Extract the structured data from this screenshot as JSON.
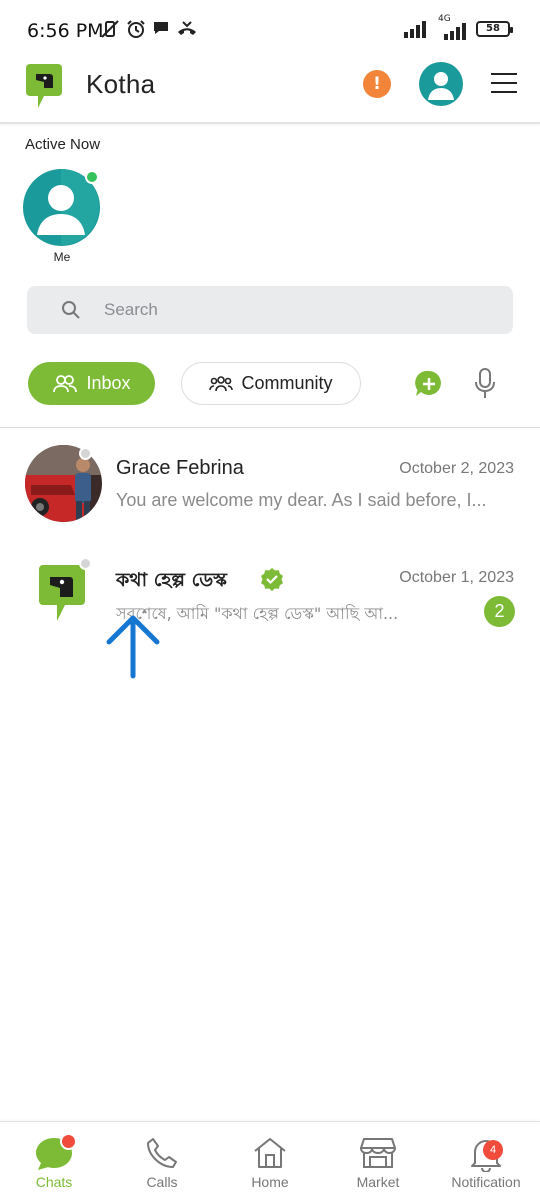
{
  "status_bar": {
    "time": "6:56 PM",
    "network": "4G",
    "battery": "58"
  },
  "header": {
    "title": "Kotha",
    "alert_symbol": "!"
  },
  "active_now": {
    "label": "Active Now",
    "users": [
      {
        "name": "Me",
        "online": true
      }
    ]
  },
  "search": {
    "placeholder": "Search"
  },
  "tabs": {
    "inbox": "Inbox",
    "community": "Community"
  },
  "chats": [
    {
      "name": "Grace Febrina",
      "date": "October 2, 2023",
      "preview": "You are welcome my dear. As I said before, I...",
      "unread": null,
      "verified": false
    },
    {
      "name": "কথা হেল্প ডেস্ক",
      "date": "October 1, 2023",
      "preview": "সবশেষে, আমি \"কথা হেল্প ডেস্ক\" আছি আ...",
      "unread": "2",
      "verified": true
    }
  ],
  "bottom_nav": {
    "items": [
      {
        "label": "Chats",
        "active": true
      },
      {
        "label": "Calls",
        "active": false
      },
      {
        "label": "Home",
        "active": false
      },
      {
        "label": "Market",
        "active": false
      },
      {
        "label": "Notification",
        "active": false,
        "badge": "4"
      }
    ]
  },
  "colors": {
    "brand_green": "#7dbb36",
    "teal": "#1a9a9a",
    "alert_orange": "#f2853a",
    "badge_red": "#f04b3b",
    "annotation_blue": "#1677d2"
  }
}
